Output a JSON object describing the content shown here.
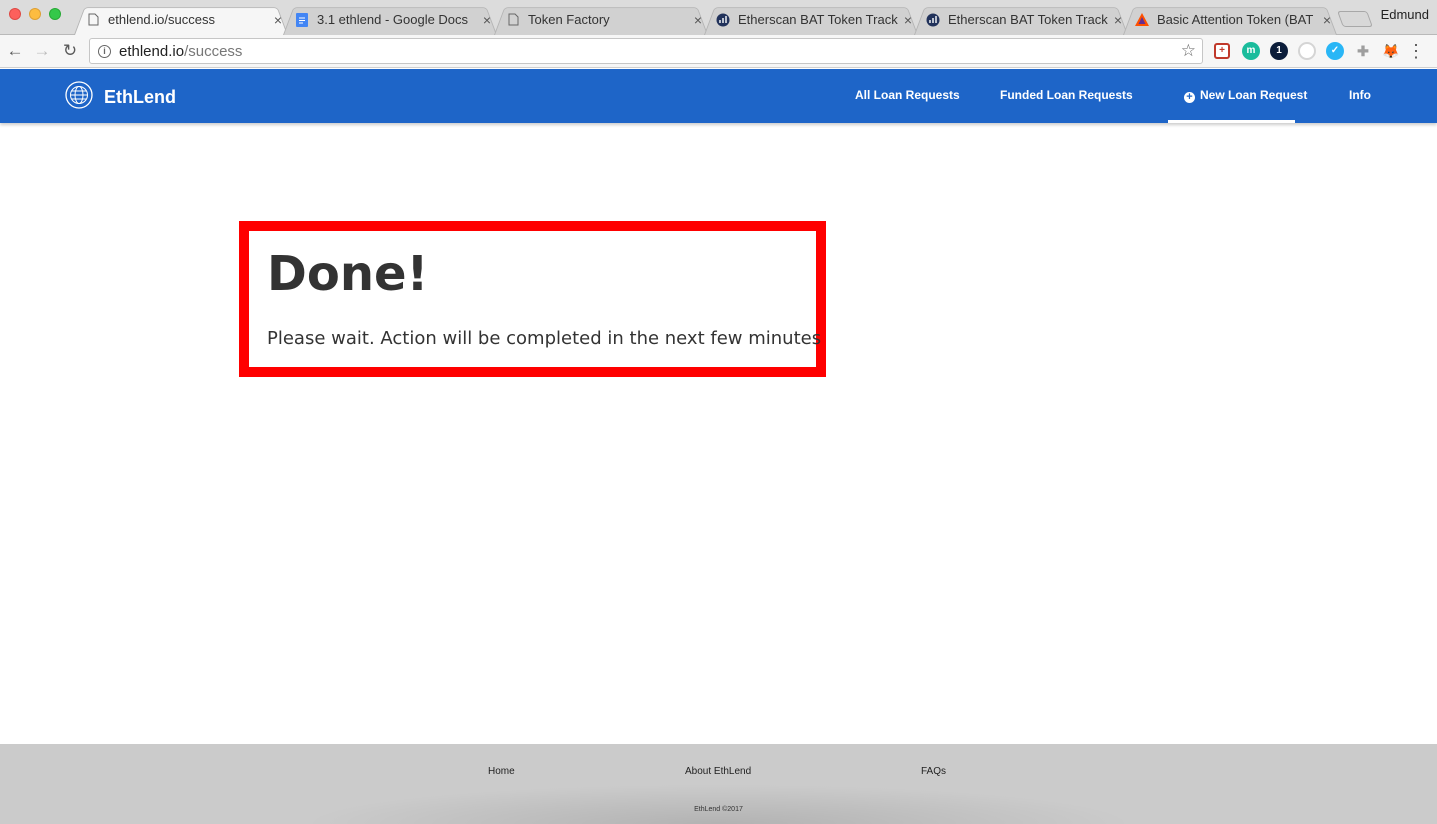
{
  "browser": {
    "tabs": [
      {
        "title": "ethlend.io/success",
        "icon": "page-icon",
        "active": true
      },
      {
        "title": "3.1 ethlend - Google Docs",
        "icon": "google-docs-icon",
        "active": false
      },
      {
        "title": "Token Factory",
        "icon": "page-icon",
        "active": false
      },
      {
        "title": "Etherscan BAT Token Track",
        "icon": "etherscan-icon",
        "active": false
      },
      {
        "title": "Etherscan BAT Token Track",
        "icon": "etherscan-icon",
        "active": false
      },
      {
        "title": "Basic Attention Token (BAT",
        "icon": "bat-icon",
        "active": false
      }
    ],
    "tab_close": "×",
    "profile_name": "Edmund",
    "url_host": "ethlend.io",
    "url_path": "/success",
    "back": "←",
    "forward": "→",
    "reload": "↻",
    "star": "☆",
    "menu": "⋮",
    "extensions": [
      {
        "name": "extension-plus-icon",
        "color": "#c0392b"
      },
      {
        "name": "extension-m-icon",
        "color": "#1abc9c",
        "text": "m"
      },
      {
        "name": "extension-1password-icon",
        "color": "#0b1d3a",
        "text": "1"
      },
      {
        "name": "extension-gray-icon",
        "color": "#d5d5d5"
      },
      {
        "name": "extension-blue-icon",
        "color": "#29b6f6"
      },
      {
        "name": "extension-puzzle-icon",
        "color": "#9e9e9e"
      },
      {
        "name": "extension-metamask-icon",
        "color": "#f6851b"
      }
    ]
  },
  "site": {
    "brand": "EthLend",
    "nav": {
      "all_loans": "All Loan Requests",
      "funded_loans": "Funded Loan Requests",
      "new_loan": "New Loan Request",
      "info": "Info"
    },
    "accent_color": "#1e65c8"
  },
  "main": {
    "title": "Done!",
    "message": "Please wait. Action will be completed in the next few minutes",
    "highlight_color": "#ff0000"
  },
  "footer": {
    "home": "Home",
    "about": "About EthLend",
    "faqs": "FAQs",
    "copyright": "EthLend ©2017"
  }
}
